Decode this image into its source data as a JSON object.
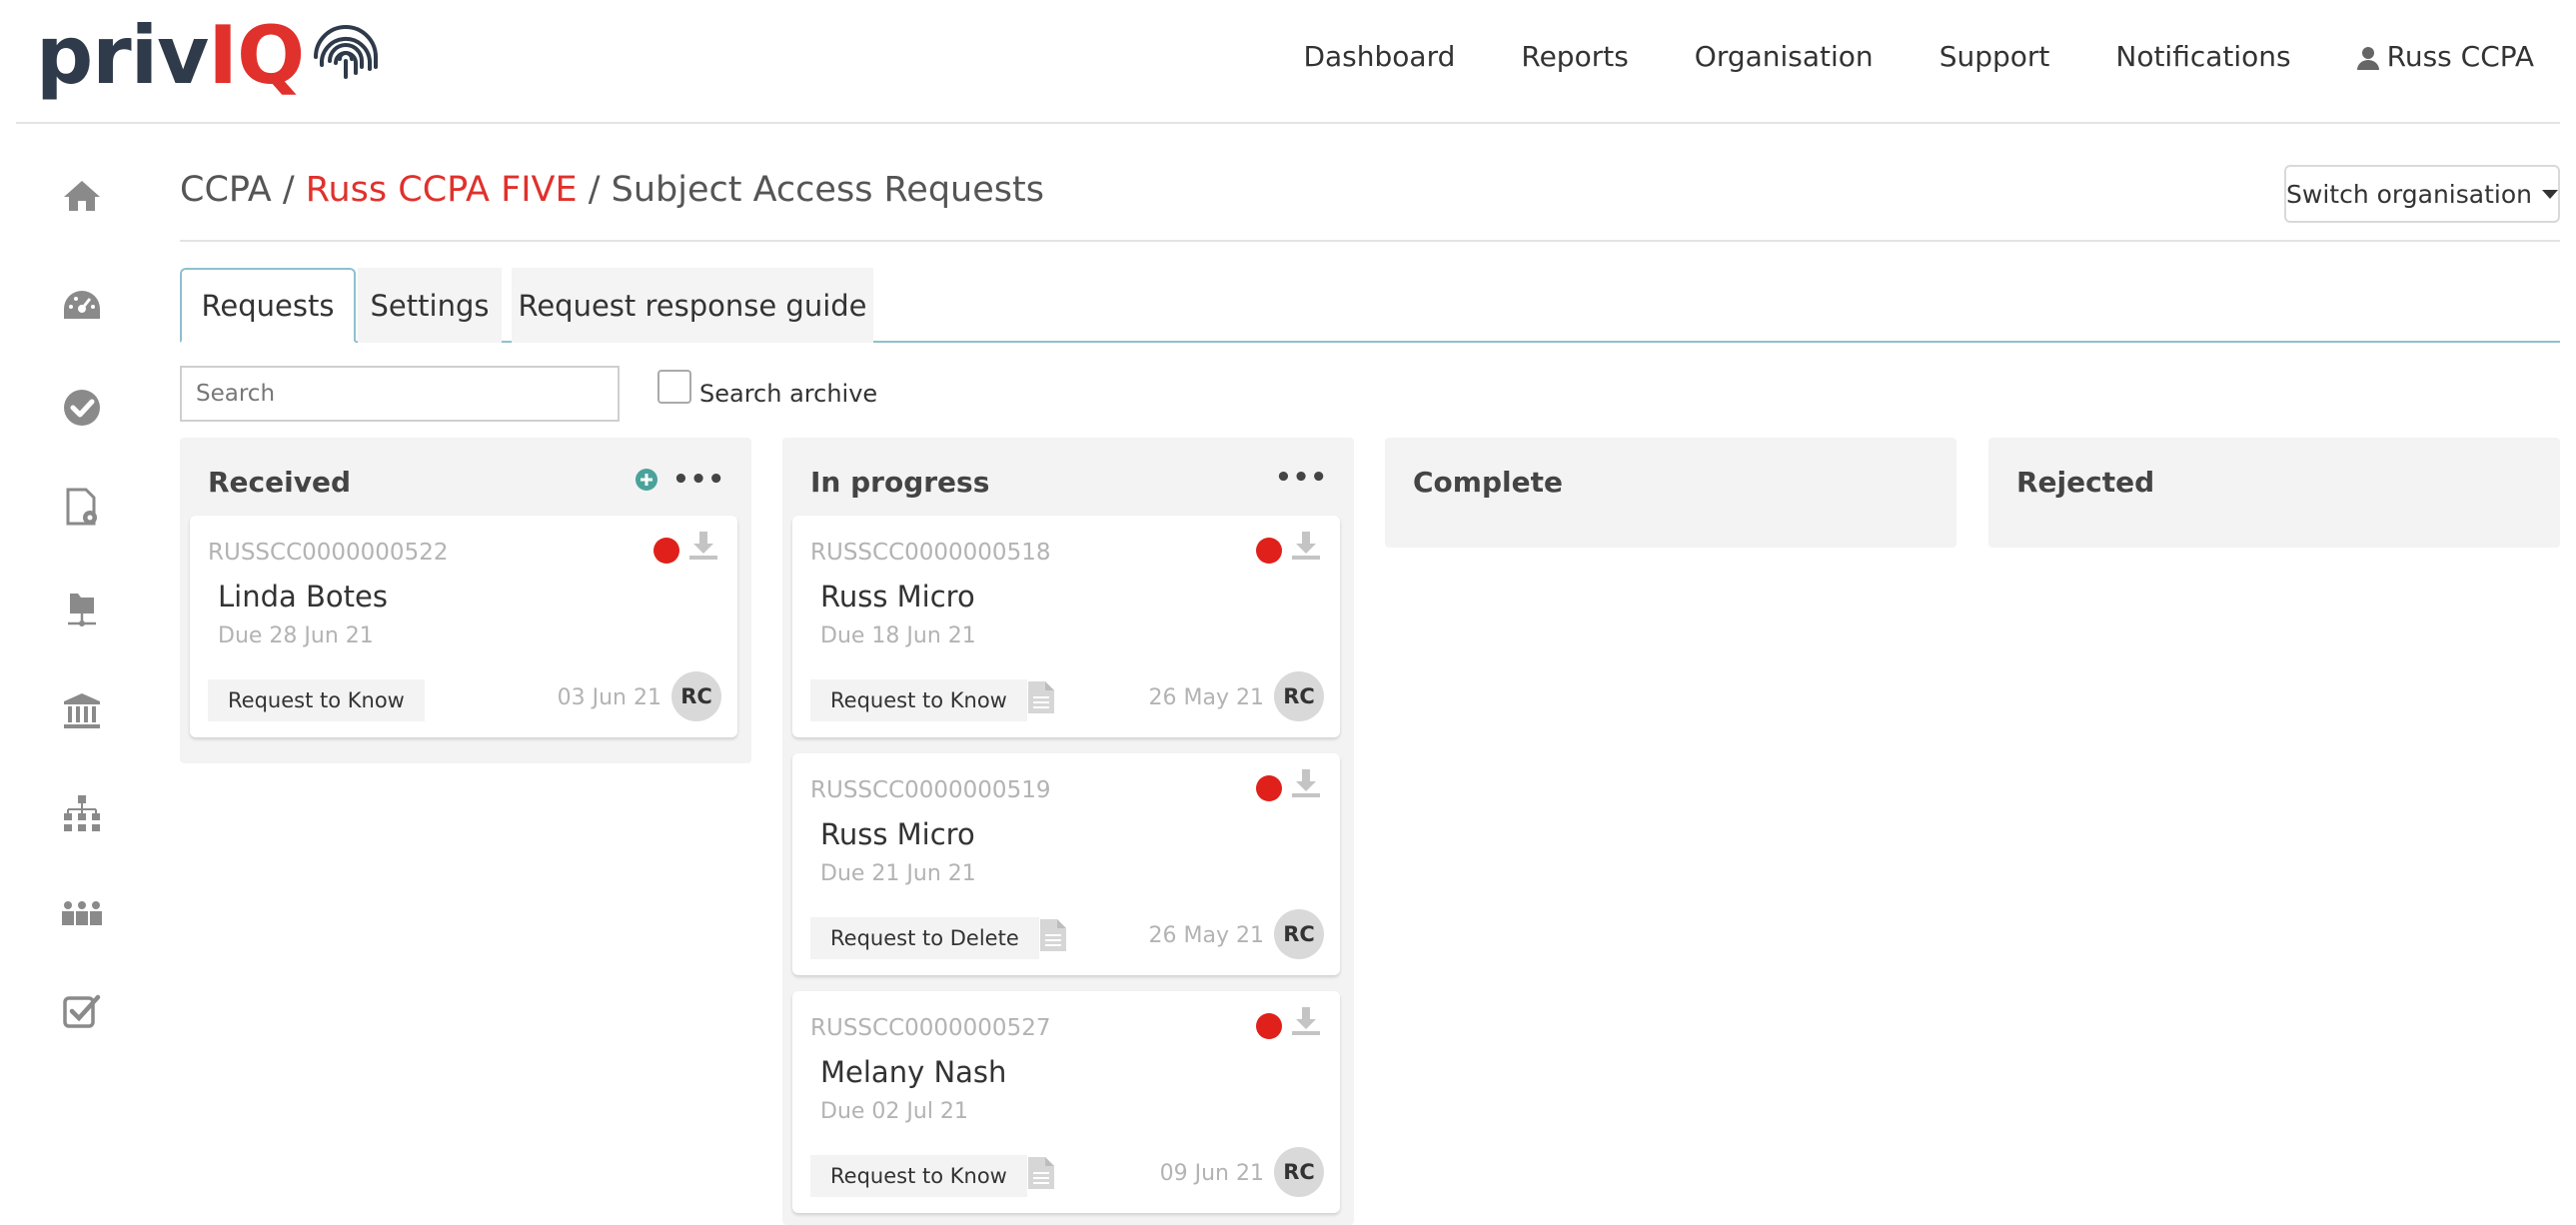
{
  "app": {
    "logo_prefix": "priv",
    "logo_highlight": "IQ",
    "accent_color": "#e0312c",
    "logo_dark_color": "#2f3a4a"
  },
  "nav": {
    "items": [
      "Dashboard",
      "Reports",
      "Organisation",
      "Support",
      "Notifications"
    ],
    "user": "Russ CCPA"
  },
  "sidebar": {
    "icons": [
      "home-icon",
      "dashboard-gauge-icon",
      "check-circle-icon",
      "document-settings-icon",
      "folder-network-icon",
      "bank-icon",
      "org-chart-icon",
      "users-group-icon",
      "checkbox-icon"
    ]
  },
  "breadcrumb": {
    "part1": "CCPA",
    "sep": " / ",
    "link": "Russ CCPA FIVE",
    "part3": "Subject Access Requests"
  },
  "switch_org": {
    "label": "Switch organisation"
  },
  "tabs": [
    {
      "label": "Requests",
      "active": true
    },
    {
      "label": "Settings",
      "active": false
    },
    {
      "label": "Request response guide",
      "active": false
    }
  ],
  "search": {
    "placeholder": "Search",
    "value": "",
    "archive_label": "Search archive",
    "archive_checked": false
  },
  "columns": {
    "received": {
      "title": "Received",
      "cards": [
        {
          "id": "RUSSCC0000000522",
          "name": "Linda Botes",
          "due": "Due 28 Jun 21",
          "type": "Request to Know",
          "date": "03 Jun 21",
          "assignee": "RC",
          "has_doc": false
        }
      ]
    },
    "in_progress": {
      "title": "In progress",
      "cards": [
        {
          "id": "RUSSCC0000000518",
          "name": "Russ Micro",
          "due": "Due 18 Jun 21",
          "type": "Request to Know",
          "date": "26 May 21",
          "assignee": "RC",
          "has_doc": true
        },
        {
          "id": "RUSSCC0000000519",
          "name": "Russ Micro",
          "due": "Due 21 Jun 21",
          "type": "Request to Delete",
          "date": "26 May 21",
          "assignee": "RC",
          "has_doc": true
        },
        {
          "id": "RUSSCC0000000527",
          "name": "Melany Nash",
          "due": "Due 02 Jul 21",
          "type": "Request to Know",
          "date": "09 Jun 21",
          "assignee": "RC",
          "has_doc": true
        }
      ]
    },
    "complete": {
      "title": "Complete",
      "cards": []
    },
    "rejected": {
      "title": "Rejected",
      "cards": []
    }
  },
  "colors": {
    "status_overdue": "#e0201b",
    "tab_border": "#8fc0cf",
    "add_icon": "#4aa39a"
  }
}
